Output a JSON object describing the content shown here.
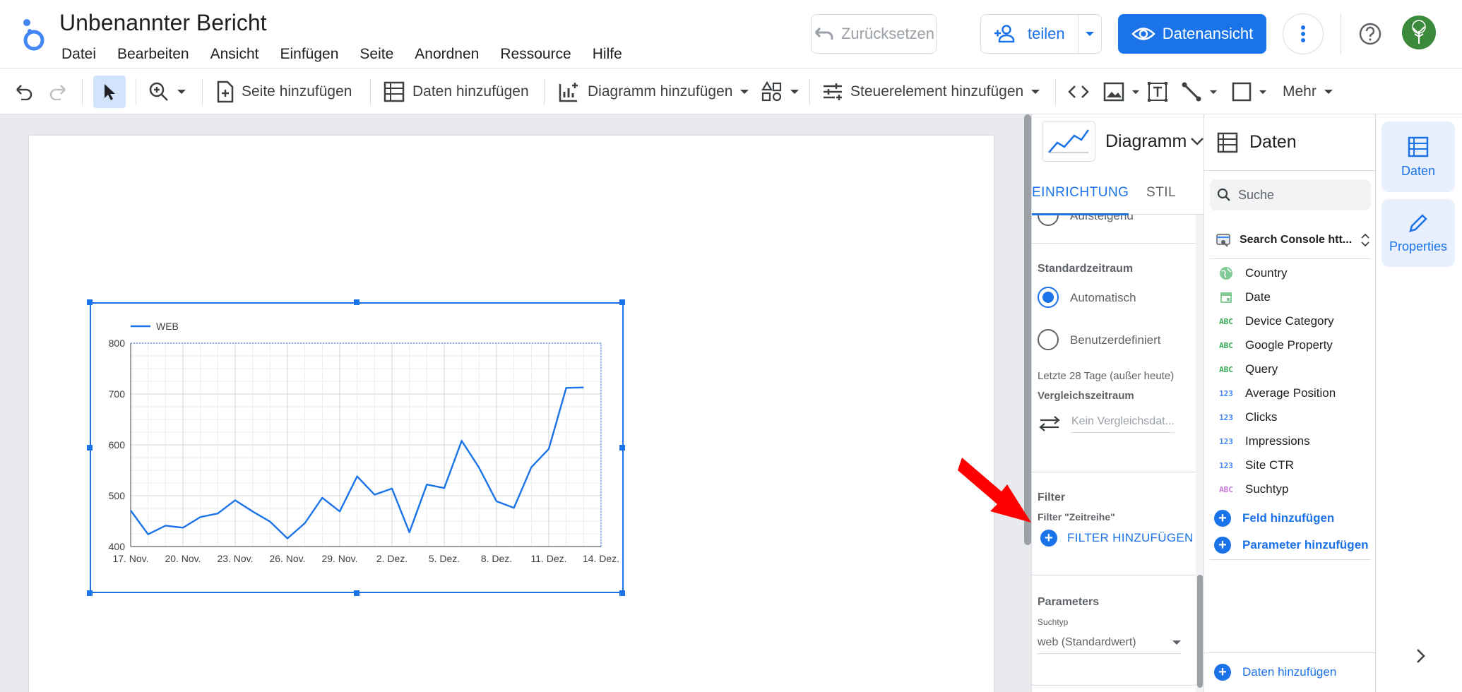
{
  "header": {
    "title": "Unbenannter Bericht",
    "menu": [
      "Datei",
      "Bearbeiten",
      "Ansicht",
      "Einfügen",
      "Seite",
      "Anordnen",
      "Ressource",
      "Hilfe"
    ],
    "undo_label": "Zurücksetzen",
    "share_label": "teilen",
    "view_label": "Datenansicht"
  },
  "toolbar": {
    "add_page": "Seite hinzufügen",
    "add_data": "Daten hinzufügen",
    "add_chart": "Diagramm hinzufügen",
    "add_control": "Steuerelement hinzufügen",
    "more": "Mehr"
  },
  "chart_data": {
    "type": "line",
    "series": [
      {
        "name": "WEB",
        "color": "#1a73e8",
        "x": [
          "2023-11-17",
          "2023-11-18",
          "2023-11-19",
          "2023-11-20",
          "2023-11-21",
          "2023-11-22",
          "2023-11-23",
          "2023-11-24",
          "2023-11-25",
          "2023-11-26",
          "2023-11-27",
          "2023-11-28",
          "2023-11-29",
          "2023-11-30",
          "2023-12-01",
          "2023-12-02",
          "2023-12-03",
          "2023-12-04",
          "2023-12-05",
          "2023-12-06",
          "2023-12-07",
          "2023-12-08",
          "2023-12-09",
          "2023-12-10",
          "2023-12-11",
          "2023-12-12",
          "2023-12-13"
        ],
        "values": [
          471,
          424,
          441,
          437,
          458,
          465,
          491,
          469,
          449,
          416,
          446,
          496,
          469,
          538,
          502,
          514,
          428,
          522,
          515,
          608,
          555,
          489,
          476,
          556,
          592,
          712,
          713
        ]
      }
    ],
    "xticks": [
      "17. Nov.",
      "20. Nov.",
      "23. Nov.",
      "26. Nov.",
      "29. Nov.",
      "2. Dez.",
      "5. Dez.",
      "8. Dez.",
      "11. Dez.",
      "14. Dez."
    ],
    "yticks": [
      "400",
      "500",
      "600",
      "700",
      "800"
    ],
    "ylim": [
      400,
      800
    ],
    "grid": true,
    "legend": "top-left"
  },
  "props": {
    "chart_type_label": "Diagramm",
    "tab_setup": "EINRICHTUNG",
    "tab_style": "STIL",
    "sort_cut_label": "Aufsteigend",
    "default_range_heading": "Standardzeitraum",
    "range_auto": "Automatisch",
    "range_custom": "Benutzerdefiniert",
    "range_note": "Letzte 28 Tage (außer heute)",
    "compare_heading": "Vergleichszeitraum",
    "compare_value": "Kein Vergleichsdat...",
    "filter_heading": "Filter",
    "filter_sub": "Filter \"Zeitreihe\"",
    "filter_add": "FILTER HINZUFÜGEN",
    "params_heading": "Parameters",
    "params_sub": "Suchtyp",
    "params_value": "web (Standardwert)"
  },
  "data_panel": {
    "title": "Daten",
    "search_placeholder": "Suche",
    "source_name": "Search Console htt...",
    "fields": [
      {
        "type": "geo",
        "name": "Country"
      },
      {
        "type": "date",
        "name": "Date"
      },
      {
        "type": "ABC",
        "name": "Device Category"
      },
      {
        "type": "ABC",
        "name": "Google Property"
      },
      {
        "type": "ABC",
        "name": "Query"
      },
      {
        "type": "123",
        "name": "Average Position"
      },
      {
        "type": "123",
        "name": "Clicks"
      },
      {
        "type": "123",
        "name": "Impressions"
      },
      {
        "type": "123",
        "name": "Site CTR"
      },
      {
        "type": "ABC",
        "name": "Suchtyp"
      }
    ],
    "add_field": "Feld hinzufügen",
    "add_param": "Parameter hinzufügen",
    "add_data": "Daten hinzufügen"
  },
  "rail": {
    "data_label": "Daten",
    "props_label": "Properties"
  },
  "colors": {
    "accent": "#1a73e8",
    "annotation_arrow": "#ff0000"
  }
}
